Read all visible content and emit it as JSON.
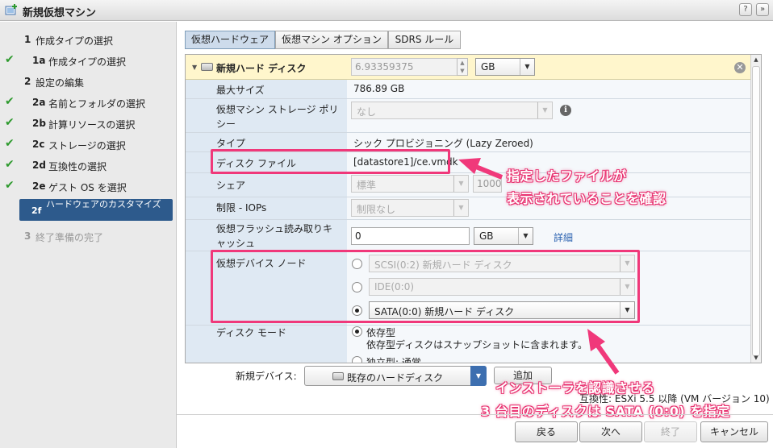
{
  "window": {
    "title": "新規仮想マシン",
    "help_label": "?",
    "expand_label": "»"
  },
  "nav": {
    "items": [
      {
        "num": "1",
        "label": "作成タイプの選択",
        "done": false
      },
      {
        "num": "1a",
        "label": "作成タイプの選択",
        "done": true
      },
      {
        "num": "2",
        "label": "設定の編集",
        "done": false
      },
      {
        "num": "2a",
        "label": "名前とフォルダの選択",
        "done": true
      },
      {
        "num": "2b",
        "label": "計算リソースの選択",
        "done": true
      },
      {
        "num": "2c",
        "label": "ストレージの選択",
        "done": true
      },
      {
        "num": "2d",
        "label": "互換性の選択",
        "done": true
      },
      {
        "num": "2e",
        "label": "ゲスト OS を選択",
        "done": true
      }
    ],
    "active": {
      "num": "2f",
      "label": "ハードウェアのカスタマイズ"
    },
    "last": {
      "num": "3",
      "label": "終了準備の完了"
    }
  },
  "tabs": [
    {
      "label": "仮想ハードウェア",
      "active": true
    },
    {
      "label": "仮想マシン オプション",
      "active": false
    },
    {
      "label": "SDRS ルール",
      "active": false
    }
  ],
  "disk": {
    "header": "新規ハード ディスク",
    "size_value": "6.93359375",
    "size_unit": "GB",
    "max_size_label": "最大サイズ",
    "max_size_value": "786.89 GB",
    "policy_label": "仮想マシン ストレージ ポリシー",
    "policy_value": "なし",
    "type_label": "タイプ",
    "type_value": "シック プロビジョニング (Lazy Zeroed)",
    "file_label": "ディスク ファイル",
    "file_value": "[datastore1]/ce.vmdk",
    "share_label": "シェア",
    "share_value": "標準",
    "share_num": "1000",
    "limit_label": "制限 - IOPs",
    "limit_value": "制限なし",
    "flash_label": "仮想フラッシュ読み取りキャッシュ",
    "flash_value": "0",
    "flash_unit": "GB",
    "flash_link": "詳細",
    "node_label": "仮想デバイス ノード",
    "nodes": [
      {
        "label": "SCSI(0:2) 新規ハード ディスク",
        "checked": false
      },
      {
        "label": "IDE(0:0)",
        "checked": false
      },
      {
        "label": "SATA(0:0) 新規ハード ディスク",
        "checked": true
      }
    ],
    "mode_label": "ディスク モード",
    "mode_value": "依存型",
    "mode_desc": "依存型ディスクはスナップショットに含まれます。",
    "mode_next": "独立型: 通常"
  },
  "callouts": {
    "file_note_1": "指定したファイルが",
    "file_note_2": "表示されていることを確認",
    "sata_note_1": "インストーラを認識させる",
    "sata_note_2": "3 台目のディスクは SATA (0:0) を指定"
  },
  "bottom": {
    "new_device_label": "新規デバイス:",
    "new_device_value": "既存のハードディスク",
    "add_label": "追加",
    "compat": "互換性: ESXi 5.5 以降 (VM バージョン 10)"
  },
  "buttons": {
    "back": "戻る",
    "next": "次へ",
    "finish": "終了",
    "cancel": "キャンセル"
  },
  "colors": {
    "accent": "#2d5a8c",
    "annotation": "#f0387a",
    "check": "#2e9a2e"
  }
}
